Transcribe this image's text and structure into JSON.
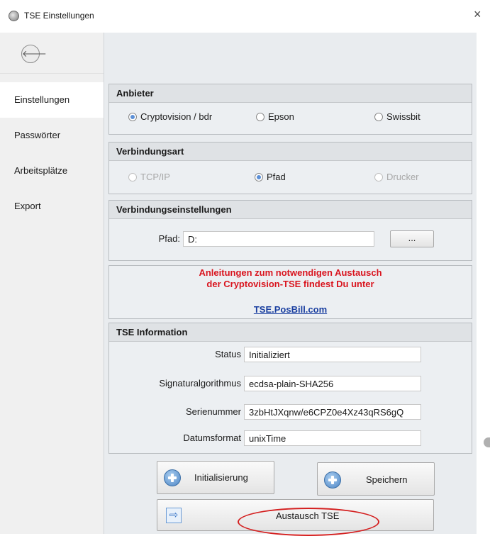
{
  "window": {
    "title": "TSE Einstellungen",
    "close_glyph": "×"
  },
  "sidebar": {
    "back_glyph": "🡐",
    "items": [
      {
        "label": "Einstellungen",
        "active": true
      },
      {
        "label": "Passwörter"
      },
      {
        "label": "Arbeitsplätze"
      },
      {
        "label": "Export"
      }
    ]
  },
  "anbieter": {
    "heading": "Anbieter",
    "options": [
      {
        "label": "Cryptovision / bdr",
        "checked": true
      },
      {
        "label": "Epson"
      },
      {
        "label": "Swissbit"
      }
    ]
  },
  "verbindungsart": {
    "heading": "Verbindungsart",
    "options": [
      {
        "label": "TCP/IP",
        "disabled": true
      },
      {
        "label": "Pfad",
        "checked": true
      },
      {
        "label": "Drucker",
        "disabled": true
      }
    ]
  },
  "verbindungseinstellungen": {
    "heading": "Verbindungseinstellungen",
    "pfad_label": "Pfad:",
    "pfad_value": "D:",
    "browse_label": "..."
  },
  "anleitung": {
    "line1": "Anleitungen zum notwendigen Austausch",
    "line2": "der Cryptovision-TSE findest Du unter",
    "link": "TSE.PosBill.com"
  },
  "tse_info": {
    "heading": "TSE Information",
    "fields": [
      {
        "label": "Status",
        "value": "Initializiert"
      },
      {
        "label": "Signaturalgorithmus",
        "value": "ecdsa-plain-SHA256"
      },
      {
        "label": "Serienummer",
        "value": "3zbHtJXqnw/e6CPZ0e4Xz43qRS6gQ"
      },
      {
        "label": "Datumsformat",
        "value": "unixTime"
      }
    ]
  },
  "buttons": {
    "initialisierung": "Initialisierung",
    "speichern": "Speichern",
    "austausch": "Austausch TSE"
  },
  "colors": {
    "accent": "#5b8fd6",
    "warning": "#d9141e",
    "link": "#1a3fa0",
    "highlight_oval": "#d42020"
  }
}
